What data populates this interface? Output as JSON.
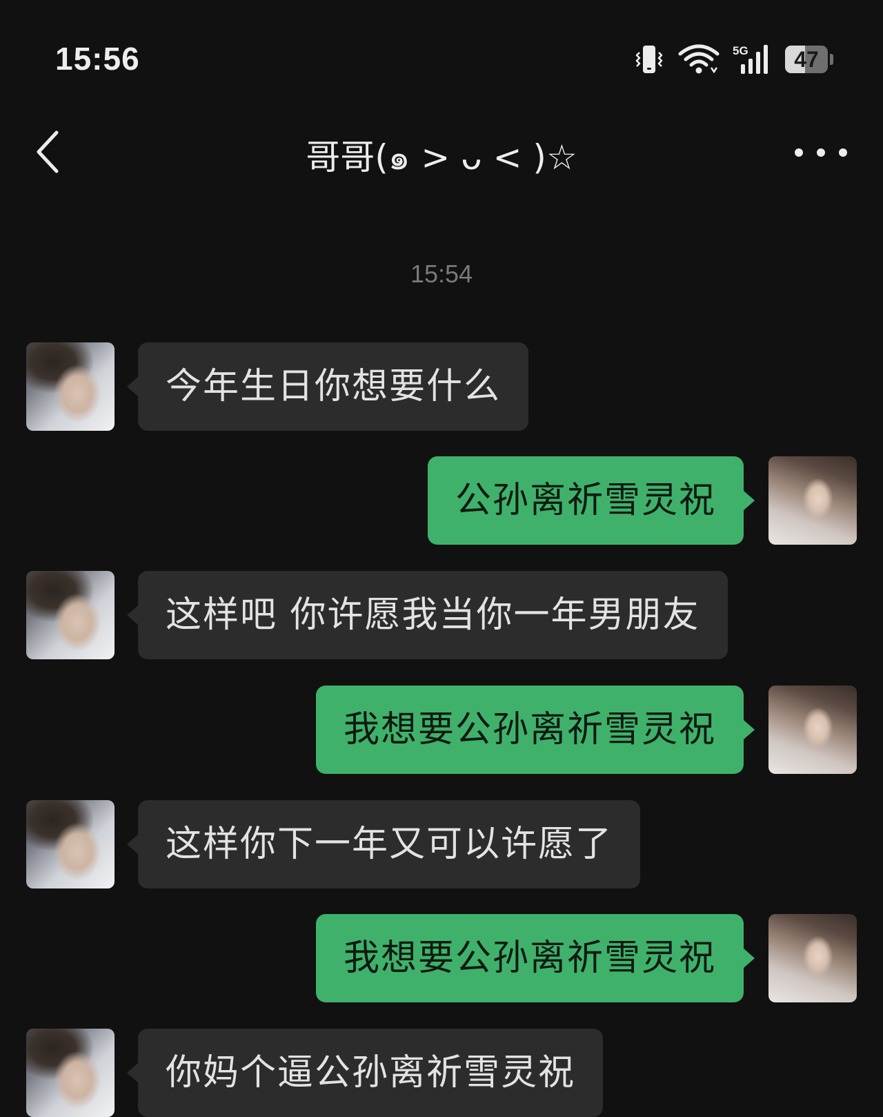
{
  "status_bar": {
    "time": "15:56",
    "network": "5G",
    "battery": "47",
    "battery_level": 0.47,
    "icons": [
      "vibrate-icon",
      "wifi-icon",
      "signal-5g-icon",
      "battery-icon"
    ]
  },
  "header": {
    "title": "哥哥(๑ > ᴗ < )☆",
    "back_icon": "chevron-left-icon",
    "more_icon": "more-dots-icon"
  },
  "timestamp": "15:54",
  "colors": {
    "background": "#111111",
    "incoming_bubble": "#2c2c2c",
    "outgoing_bubble": "#3fb16b"
  },
  "messages": [
    {
      "side": "left",
      "text": "今年生日你想要什么"
    },
    {
      "side": "right",
      "text": "公孙离祈雪灵祝"
    },
    {
      "side": "left",
      "text": "这样吧  你许愿我当你一年男朋友"
    },
    {
      "side": "right",
      "text": "我想要公孙离祈雪灵祝"
    },
    {
      "side": "left",
      "text": "这样你下一年又可以许愿了"
    },
    {
      "side": "right",
      "text": "我想要公孙离祈雪灵祝"
    },
    {
      "side": "left",
      "text": "你妈个逼公孙离祈雪灵祝"
    }
  ]
}
